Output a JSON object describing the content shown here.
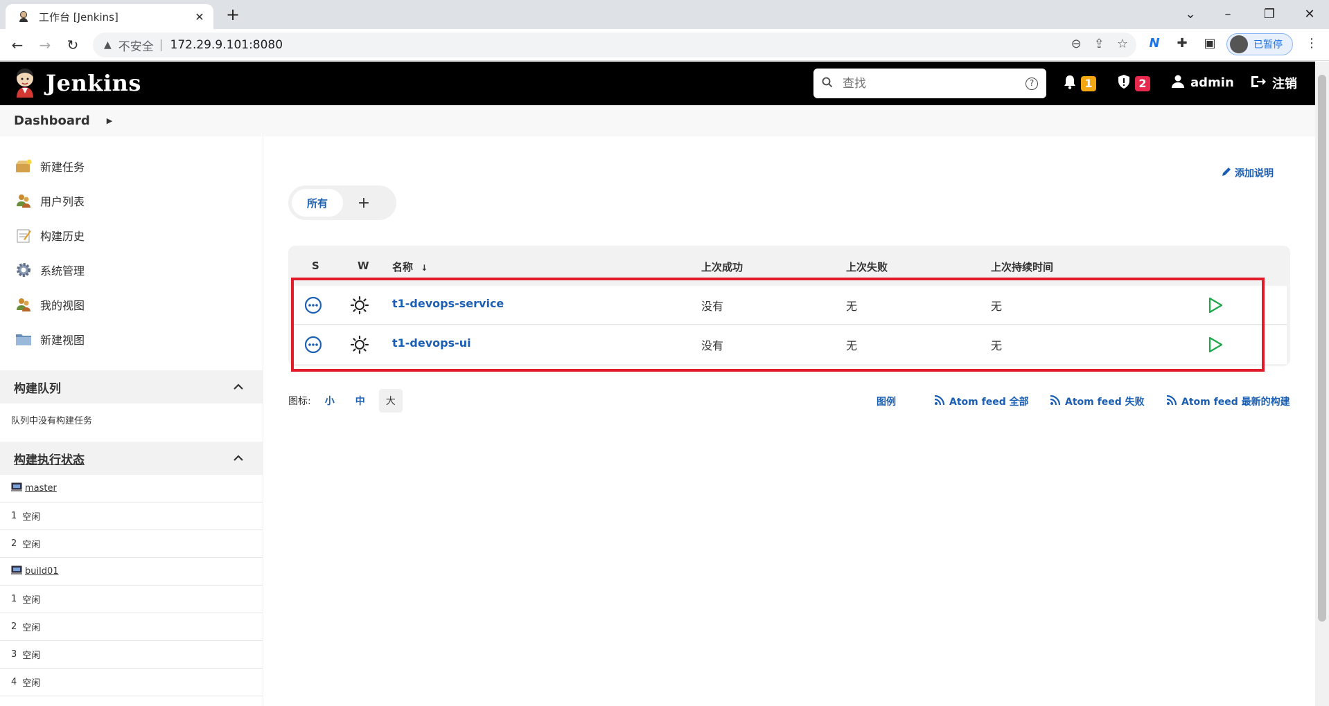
{
  "browser": {
    "tab_title": "工作台 [Jenkins]",
    "address_insecure": "不安全",
    "address_url": "172.29.9.101:8080",
    "profile_label": "已暂停"
  },
  "header": {
    "brand": "Jenkins",
    "search_placeholder": "查找",
    "notifications_count": "1",
    "security_count": "2",
    "user": "admin",
    "logout": "注销",
    "colors": {
      "notif_badge": "#f3a712",
      "security_badge": "#e6294d"
    }
  },
  "breadcrumb": {
    "root": "Dashboard"
  },
  "sidebar": {
    "tasks": [
      {
        "label": "新建任务",
        "icon": "new-item-icon"
      },
      {
        "label": "用户列表",
        "icon": "people-icon"
      },
      {
        "label": "构建历史",
        "icon": "notepad-icon"
      },
      {
        "label": "系统管理",
        "icon": "gear-icon"
      },
      {
        "label": "我的视图",
        "icon": "user-view-icon"
      },
      {
        "label": "新建视图",
        "icon": "folder-icon"
      }
    ],
    "build_queue": {
      "title": "构建队列",
      "empty_text": "队列中没有构建任务"
    },
    "executors": {
      "title": "构建执行状态",
      "nodes": [
        {
          "name": "master",
          "slots": [
            {
              "num": "1",
              "state": "空闲"
            },
            {
              "num": "2",
              "state": "空闲"
            }
          ]
        },
        {
          "name": "build01",
          "slots": [
            {
              "num": "1",
              "state": "空闲"
            },
            {
              "num": "2",
              "state": "空闲"
            },
            {
              "num": "3",
              "state": "空闲"
            },
            {
              "num": "4",
              "state": "空闲"
            }
          ]
        }
      ]
    }
  },
  "main": {
    "add_description": "添加说明",
    "view_tabs": {
      "active": "所有",
      "add": "+"
    },
    "table": {
      "headers": {
        "s": "S",
        "w": "W",
        "name": "名称",
        "sort": "↓",
        "last_success": "上次成功",
        "last_failure": "上次失败",
        "last_duration": "上次持续时间"
      },
      "rows": [
        {
          "name": "t1-devops-service",
          "last_success": "没有",
          "last_failure": "无",
          "last_duration": "无"
        },
        {
          "name": "t1-devops-ui",
          "last_success": "没有",
          "last_failure": "无",
          "last_duration": "无"
        }
      ]
    },
    "icon_size": {
      "label": "图标:",
      "small": "小",
      "medium": "中",
      "large": "大",
      "active": "大"
    },
    "feeds": {
      "legend": "图例",
      "all": "Atom feed 全部",
      "failed": "Atom feed 失败",
      "latest": "Atom feed 最新的构建"
    }
  }
}
